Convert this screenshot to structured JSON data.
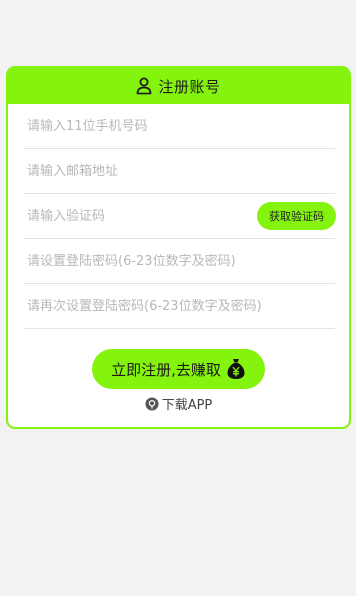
{
  "colors": {
    "accent": "#84f30d",
    "background": "#f2f2f2",
    "card": "#ffffff",
    "placeholder": "#b8b8b8",
    "divider": "#e3e3e3"
  },
  "header": {
    "icon": "user-icon",
    "title": "注册账号"
  },
  "form": {
    "phone": {
      "value": "",
      "placeholder": "请输入11位手机号码"
    },
    "email": {
      "value": "",
      "placeholder": "请输入邮箱地址"
    },
    "code": {
      "value": "",
      "placeholder": "请输入验证码",
      "button_label": "获取验证码"
    },
    "password": {
      "value": "",
      "placeholder": "请设置登陆密码(6-23位数字及密码)"
    },
    "confirm_password": {
      "value": "",
      "placeholder": "请再次设置登陆密码(6-23位数字及密码)"
    }
  },
  "submit": {
    "label": "立即注册,去赚取",
    "icon": "money-bag-icon"
  },
  "download": {
    "icon": "download-icon",
    "label": "下载APP"
  }
}
